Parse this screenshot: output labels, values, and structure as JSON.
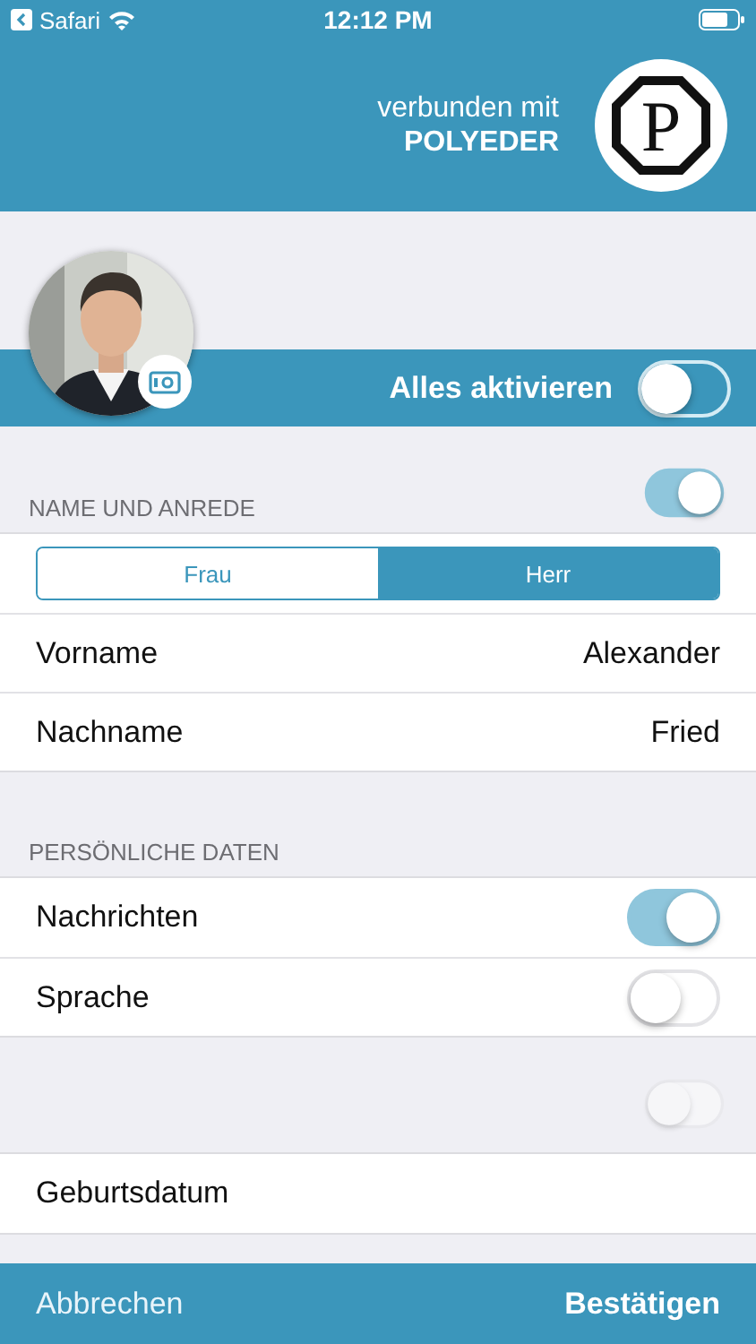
{
  "status_bar": {
    "back_label": "Safari",
    "time": "12:12 PM"
  },
  "header": {
    "connected_label": "verbunden mit",
    "brand": "POLYEDER",
    "logo_letter": "P"
  },
  "profile": {
    "activate_all": {
      "label": "Alles aktivieren",
      "on": false
    }
  },
  "sections": [
    {
      "title": "NAME UND ANREDE",
      "toggle": {
        "on": true,
        "disabled": false
      },
      "segments": [
        {
          "label": "Frau",
          "selected": false
        },
        {
          "label": "Herr",
          "selected": true
        }
      ],
      "rows": [
        {
          "kind": "value",
          "label": "Vorname",
          "value": "Alexander"
        },
        {
          "kind": "value",
          "label": "Nachname",
          "value": "Fried"
        }
      ]
    },
    {
      "title": "PERSÖNLICHE DATEN",
      "rows": [
        {
          "kind": "switch",
          "label": "Nachrichten",
          "on": true
        },
        {
          "kind": "switch",
          "label": "Sprache",
          "on": false
        }
      ]
    },
    {
      "toggle": {
        "on": false,
        "disabled": true
      },
      "rows": [
        {
          "kind": "value",
          "label": "Geburtsdatum"
        }
      ]
    }
  ],
  "footer": {
    "cancel": "Abbrechen",
    "confirm": "Bestätigen"
  }
}
